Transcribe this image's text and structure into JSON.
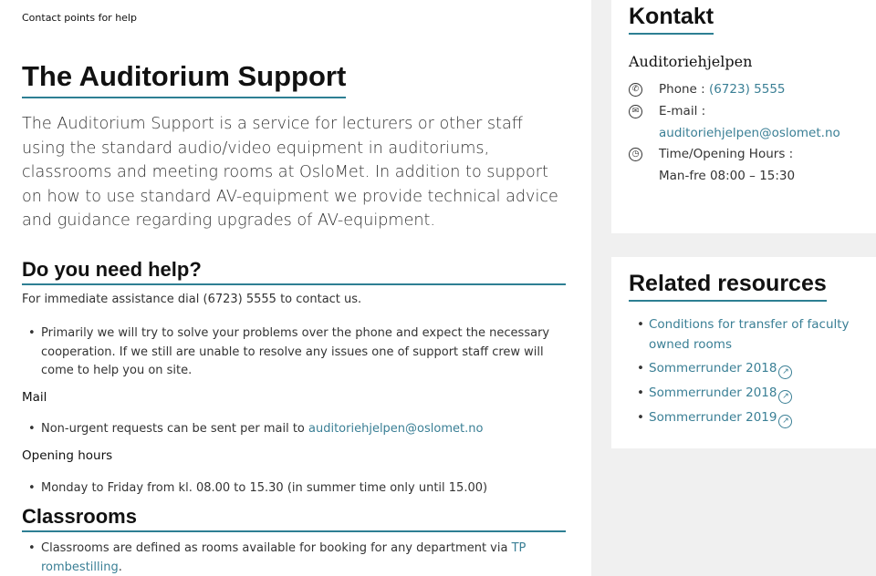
{
  "breadcrumb": "Contact points for help",
  "page_title": "The Auditorium Support",
  "lead": "The Auditorium Support is a service for lecturers or other staff using the standard audio/video equipment in auditoriums, classrooms and meeting rooms at OsloMet. In addition to support on how to use standard AV-equipment we provide technical advice and guidance regarding upgrades of AV-equipment.",
  "help": {
    "heading": "Do you need help?",
    "intro": "For immediate assistance dial (6723) 5555 to contact us.",
    "bullet1": "Primarily we will try to solve your problems over the phone and expect the necessary cooperation. If we still are unable to resolve any issues one of support staff crew will come to help you on site.",
    "mail_heading": "Mail",
    "mail_bullet_text": "Non-urgent requests can be sent per mail to ",
    "mail_link": "auditoriehjelpen@oslomet.no",
    "hours_heading": "Opening hours",
    "hours_bullet": "Monday to Friday from kl. 08.00 to 15.30 (in summer time only until 15.00)"
  },
  "classrooms": {
    "heading": "Classrooms",
    "bullet_text": "Classrooms are defined as rooms available for booking for any department via ",
    "bullet_link": "TP rombestilling",
    "bullet_end": "."
  },
  "contact": {
    "title": "Kontakt",
    "name": "Auditoriehjelpen",
    "phone_label": "Phone : ",
    "phone_value": "(6723) 5555",
    "email_label": "E-mail :",
    "email_value": "auditoriehjelpen@oslomet.no",
    "hours_label": "Time/Opening Hours :",
    "hours_value": "Man-fre 08:00 – 15:30",
    "icons": [
      "phone-icon",
      "mail-icon",
      "clock-icon"
    ]
  },
  "related": {
    "title": "Related resources",
    "items": [
      "Conditions for transfer of faculty owned rooms",
      "Sommerrunder 2018",
      "Sommerrunder 2018",
      "Sommerrunder 2019"
    ]
  },
  "colors": {
    "accent": "#2d7f93",
    "link": "#3a7f95",
    "sidebar_bg": "#f0f0f0"
  }
}
